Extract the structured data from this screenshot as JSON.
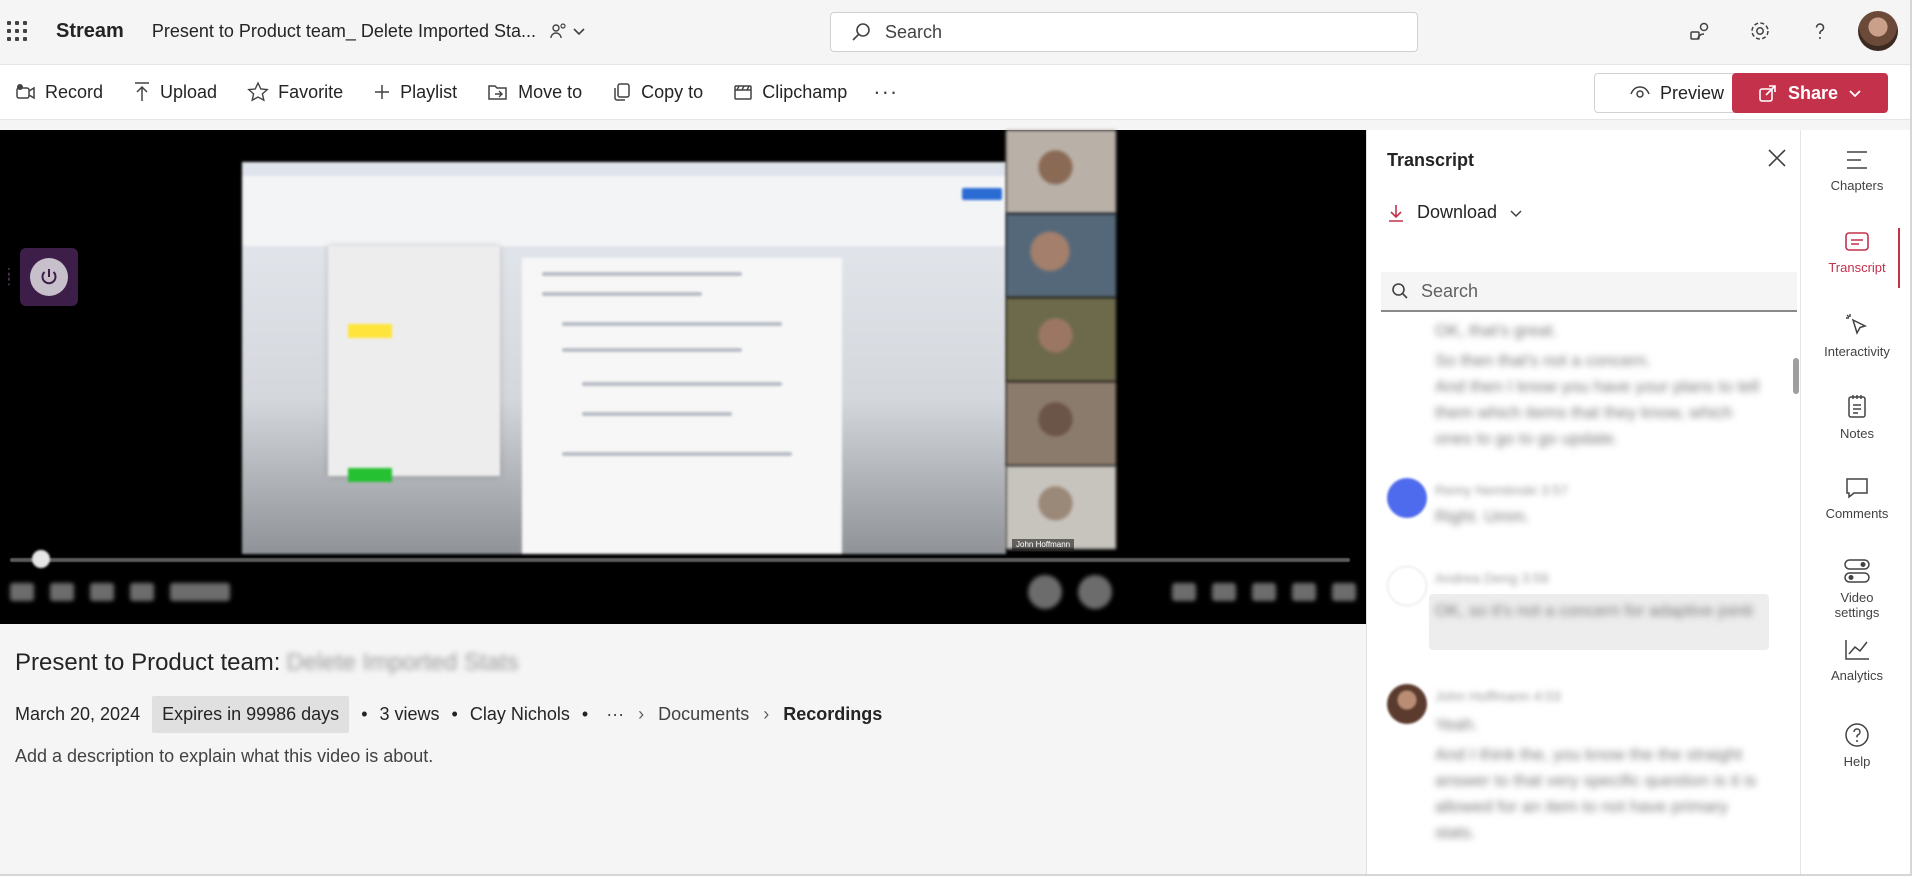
{
  "app": {
    "name": "Stream",
    "doc_title": "Present to Product team_ Delete Imported Sta..."
  },
  "header": {
    "search_placeholder": "Search"
  },
  "toolbar": {
    "record": "Record",
    "upload": "Upload",
    "favorite": "Favorite",
    "playlist": "Playlist",
    "move_to": "Move to",
    "copy_to": "Copy to",
    "clipchamp": "Clipchamp",
    "more": "···",
    "preview": "Preview",
    "share": "Share"
  },
  "video": {
    "participant_label": "John Hoffmann",
    "title": "Present to Product team:",
    "title_blurred": "Delete Imported Stats",
    "date": "March 20, 2024",
    "expires": "Expires in 99986 days",
    "views": "3 views",
    "owner": "Clay Nichols",
    "breadcrumb_more": "···",
    "breadcrumb": [
      "Documents",
      "Recordings"
    ],
    "description_placeholder": "Add a description to explain what this video is about."
  },
  "transcript": {
    "title": "Transcript",
    "download": "Download",
    "search_placeholder": "Search",
    "entries": [
      {
        "text": "OK, that's great."
      },
      {
        "text": "So then that's not a concern."
      },
      {
        "text": "And then I know you have your plans to tell them which items that they know, which ones to go to go update."
      },
      {
        "speaker": "Remy Nemtinski",
        "time": "3:57",
        "text": "Right. Umm."
      },
      {
        "speaker": "Andrea Deng",
        "time": "3:59",
        "text": "OK, so it's not a concern for adaptive jointi"
      },
      {
        "speaker": "John Hoffmann",
        "time": "4:03",
        "text": "Yeah."
      },
      {
        "text": "And I think the, you know the the straight answer to that very specific question is it is allowed for an item to not have primary stats."
      }
    ]
  },
  "rail": {
    "chapters": "Chapters",
    "transcript": "Transcript",
    "interactivity": "Interactivity",
    "notes": "Notes",
    "comments": "Comments",
    "video_settings_line1": "Video",
    "video_settings_line2": "settings",
    "analytics": "Analytics",
    "help": "Help"
  },
  "colors": {
    "accent": "#c4314b",
    "background": "#f5f5f5"
  }
}
